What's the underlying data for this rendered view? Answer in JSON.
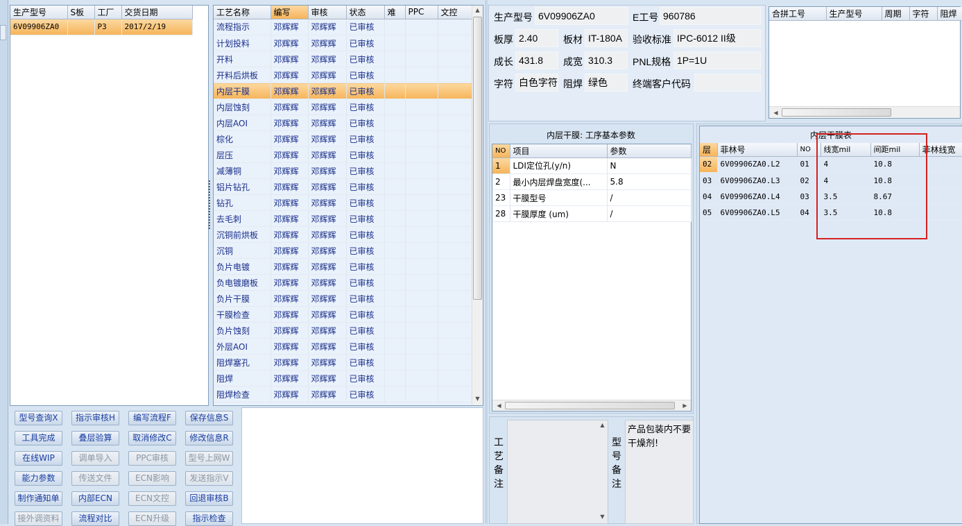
{
  "product_list": {
    "columns": [
      "生产型号",
      "S板",
      "工厂",
      "交货日期"
    ],
    "rows": [
      [
        "6V09906ZA0",
        "",
        "P3",
        "2017/2/19"
      ]
    ]
  },
  "process_list": {
    "columns": [
      "工艺名称",
      "编写",
      "审核",
      "状态",
      "难",
      "PPC",
      "文控"
    ],
    "rows": [
      [
        "流程指示",
        "邓辉辉",
        "邓辉辉",
        "已审核"
      ],
      [
        "计划投料",
        "邓辉辉",
        "邓辉辉",
        "已审核"
      ],
      [
        "开料",
        "邓辉辉",
        "邓辉辉",
        "已审核"
      ],
      [
        "开料后烘板",
        "邓辉辉",
        "邓辉辉",
        "已审核"
      ],
      [
        "内层干膜",
        "邓辉辉",
        "邓辉辉",
        "已审核"
      ],
      [
        "内层蚀刻",
        "邓辉辉",
        "邓辉辉",
        "已审核"
      ],
      [
        "内层AOI",
        "邓辉辉",
        "邓辉辉",
        "已审核"
      ],
      [
        "棕化",
        "邓辉辉",
        "邓辉辉",
        "已审核"
      ],
      [
        "层压",
        "邓辉辉",
        "邓辉辉",
        "已审核"
      ],
      [
        "减薄铜",
        "邓辉辉",
        "邓辉辉",
        "已审核"
      ],
      [
        "铝片钻孔",
        "邓辉辉",
        "邓辉辉",
        "已审核"
      ],
      [
        "钻孔",
        "邓辉辉",
        "邓辉辉",
        "已审核"
      ],
      [
        "去毛刺",
        "邓辉辉",
        "邓辉辉",
        "已审核"
      ],
      [
        "沉铜前烘板",
        "邓辉辉",
        "邓辉辉",
        "已审核"
      ],
      [
        "沉铜",
        "邓辉辉",
        "邓辉辉",
        "已审核"
      ],
      [
        "负片电镀",
        "邓辉辉",
        "邓辉辉",
        "已审核"
      ],
      [
        "负电镀磨板",
        "邓辉辉",
        "邓辉辉",
        "已审核"
      ],
      [
        "负片干膜",
        "邓辉辉",
        "邓辉辉",
        "已审核"
      ],
      [
        "干膜检查",
        "邓辉辉",
        "邓辉辉",
        "已审核"
      ],
      [
        "负片蚀刻",
        "邓辉辉",
        "邓辉辉",
        "已审核"
      ],
      [
        "外层AOI",
        "邓辉辉",
        "邓辉辉",
        "已审核"
      ],
      [
        "阻焊塞孔",
        "邓辉辉",
        "邓辉辉",
        "已审核"
      ],
      [
        "阻焊",
        "邓辉辉",
        "邓辉辉",
        "已审核"
      ],
      [
        "阻焊检查",
        "邓辉辉",
        "邓辉辉",
        "已审核"
      ]
    ]
  },
  "buttons": [
    [
      "型号查询X",
      "指示审核H",
      "编写流程F",
      "保存信息S"
    ],
    [
      "工具完成",
      "叠层验算",
      "取消修改C",
      "修改信息R"
    ],
    [
      "在线WIP",
      "调单导入",
      "PPC审核",
      "型号上网W"
    ],
    [
      "能力参数",
      "传送文件",
      "ECN影响",
      "发送指示V"
    ],
    [
      "制作通知单",
      "内部ECN",
      "ECN文控",
      "回退审核B"
    ],
    [
      "接外调资料",
      "流程对比",
      "ECN升级",
      "指示检查"
    ]
  ],
  "info": {
    "prod_model_label": "生产型号",
    "prod_model": "6V09906ZA0",
    "e_no_label": "E工号",
    "e_no": "960786",
    "thickness_label": "板厚",
    "thickness": "2.40",
    "material_label": "板材",
    "material": "IT-180A",
    "standard_label": "验收标准",
    "standard": "IPC-6012 II级",
    "length_label": "成长",
    "length": "431.8",
    "width_label": "成宽",
    "width": "310.3",
    "pnl_label": "PNL规格",
    "pnl": "1P=1U",
    "char_label": "字符",
    "char": "白色字符",
    "mask_label": "阻焊",
    "mask": "绿色",
    "customer_label": "终端客户代码",
    "customer": ""
  },
  "merge_table": {
    "columns": [
      "合拼工号",
      "生产型号",
      "周期",
      "字符",
      "阻焊"
    ]
  },
  "params": {
    "title": "内层干膜: 工序基本参数",
    "columns": [
      "NO",
      "项目",
      "参数"
    ],
    "rows": [
      [
        "1",
        "LDI定位孔(y/n)",
        "N"
      ],
      [
        "2",
        "最小内层焊盘宽度(...",
        "5.8"
      ],
      [
        "23",
        "干膜型号",
        "/"
      ],
      [
        "28",
        "干膜厚度 (um)",
        "/"
      ]
    ]
  },
  "film": {
    "title": "内层干膜表",
    "columns": [
      "层",
      "菲林号",
      "NO",
      "线宽mil",
      "间距mil",
      "菲林线宽"
    ],
    "rows": [
      [
        "02",
        "6V09906ZA0.L2",
        "01",
        "4",
        "10.8"
      ],
      [
        "03",
        "6V09906ZA0.L3",
        "02",
        "4",
        "10.8"
      ],
      [
        "04",
        "6V09906ZA0.L4",
        "03",
        "3.5",
        "8.67"
      ],
      [
        "05",
        "6V09906ZA0.L5",
        "04",
        "3.5",
        "10.8"
      ]
    ]
  },
  "notes": {
    "process_label": "工艺备注",
    "model_label": "型号备注",
    "model_text": "产品包装内不要干燥剂!"
  },
  "colors": {
    "selected_row": "#f6b45a",
    "highlight_box": "#d42020",
    "button_text": "#1a3ea0"
  }
}
